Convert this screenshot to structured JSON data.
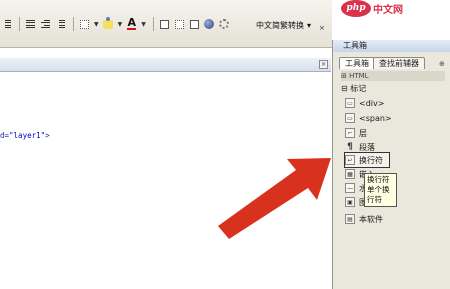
{
  "toolbar": {
    "encoding_dropdown": "中文简繁转换",
    "dropdown_caret": "▾",
    "close_x": "×"
  },
  "document": {
    "code_attr": "d=",
    "code_value": "\"layer1\"",
    "code_tail": ">",
    "close_label": "×"
  },
  "panel": {
    "title": "工具箱",
    "pin": "⊕",
    "tabs": [
      "工具箱",
      "查找前辅器"
    ],
    "category_html": "⊞ HTML",
    "category_markup": "⊟ 标记",
    "items": [
      {
        "label": "<div>",
        "icon": "div-icon"
      },
      {
        "label": "<span>",
        "icon": "span-icon"
      },
      {
        "label": "层",
        "icon": "layer-icon"
      },
      {
        "label": "段落",
        "icon": "paragraph-icon"
      },
      {
        "label": "换行符",
        "icon": "line-break-icon"
      },
      {
        "label": "嵌入",
        "icon": "embed-icon"
      },
      {
        "label": "水平",
        "icon": "horizontal-rule-icon"
      },
      {
        "label": "图像",
        "icon": "image-icon"
      },
      {
        "label": "本软件",
        "icon": "component-icon"
      }
    ]
  },
  "tooltip": {
    "line1": "换行符",
    "line2": "单个换",
    "line3": "行符"
  },
  "watermark": {
    "logo": "php",
    "text": "中文网"
  },
  "colors": {
    "arrow": "#d8321f",
    "accent": "#d9324a"
  }
}
